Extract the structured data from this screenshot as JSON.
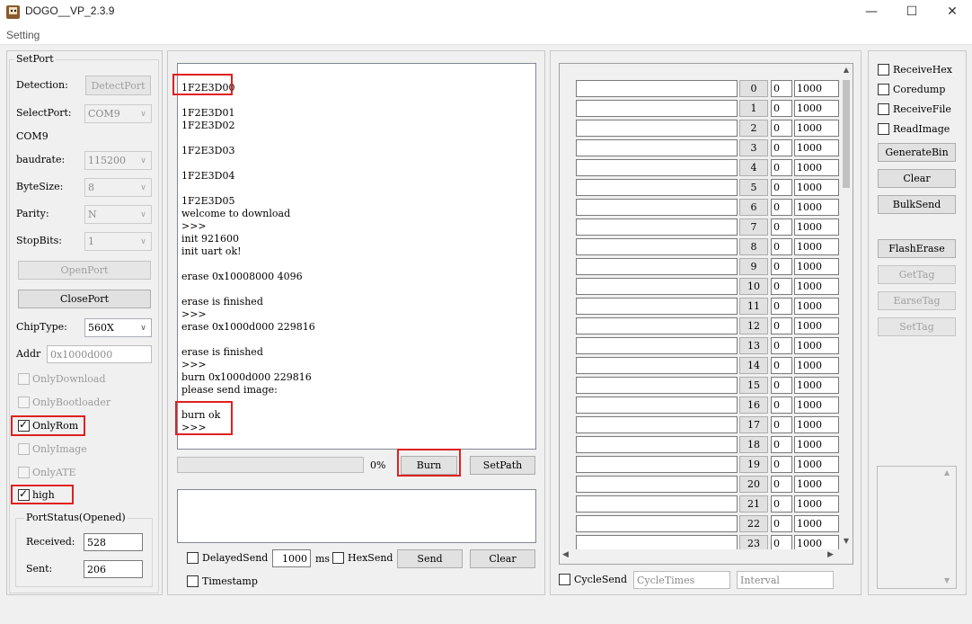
{
  "window": {
    "title": "DOGO__VP_2.3.9",
    "min": "—",
    "max": "☐",
    "close": "✕"
  },
  "menu": {
    "setting": "Setting"
  },
  "setport": {
    "legend": "SetPort",
    "detection_label": "Detection:",
    "detect_button": "DetectPort",
    "selectport_label": "SelectPort:",
    "selectport_value": "COM9",
    "com_text": "COM9",
    "baudrate_label": "baudrate:",
    "baudrate_value": "115200",
    "bytesize_label": "ByteSize:",
    "bytesize_value": "8",
    "parity_label": "Parity:",
    "parity_value": "N",
    "stopbits_label": "StopBits:",
    "stopbits_value": "1",
    "openport_button": "OpenPort",
    "closeport_button": "ClosePort",
    "chiptype_label": "ChipType:",
    "chiptype_value": "560X",
    "addr_label": "Addr",
    "addr_value": "0x1000d000",
    "only_download": "OnlyDownload",
    "only_bootloader": "OnlyBootloader",
    "only_rom": "OnlyRom",
    "only_image": "OnlyImage",
    "only_ate": "OnlyATE",
    "high": "high"
  },
  "portstatus": {
    "legend": "PortStatus(Opened)",
    "received_label": "Received:",
    "received_value": "528",
    "sent_label": "Sent:",
    "sent_value": "206"
  },
  "console": {
    "lines": [
      "",
      "1F2E3D00",
      "",
      "1F2E3D01",
      "1F2E3D02",
      "",
      "1F2E3D03",
      "",
      "1F2E3D04",
      "",
      "1F2E3D05",
      "welcome to download",
      ">>>",
      "init 921600",
      "init uart ok!",
      "",
      "erase 0x10008000 4096",
      "",
      "erase is finished",
      ">>>",
      "erase 0x1000d000 229816",
      "",
      "erase is finished",
      ">>>",
      "burn 0x1000d000 229816",
      "please send image:",
      "",
      "burn ok",
      ">>>"
    ]
  },
  "progress": {
    "percent_text": "0%",
    "fraction": 0
  },
  "buttons": {
    "burn": "Burn",
    "setpath": "SetPath",
    "send": "Send",
    "clear": "Clear"
  },
  "send_options": {
    "delayed_send": "DelayedSend",
    "delay_value": "1000",
    "ms": "ms",
    "hex_send": "HexSend",
    "timestamp": "Timestamp"
  },
  "multi_send": {
    "rows": [
      {
        "num": "0",
        "flag": "0",
        "delay": "1000"
      },
      {
        "num": "1",
        "flag": "0",
        "delay": "1000"
      },
      {
        "num": "2",
        "flag": "0",
        "delay": "1000"
      },
      {
        "num": "3",
        "flag": "0",
        "delay": "1000"
      },
      {
        "num": "4",
        "flag": "0",
        "delay": "1000"
      },
      {
        "num": "5",
        "flag": "0",
        "delay": "1000"
      },
      {
        "num": "6",
        "flag": "0",
        "delay": "1000"
      },
      {
        "num": "7",
        "flag": "0",
        "delay": "1000"
      },
      {
        "num": "8",
        "flag": "0",
        "delay": "1000"
      },
      {
        "num": "9",
        "flag": "0",
        "delay": "1000"
      },
      {
        "num": "10",
        "flag": "0",
        "delay": "1000"
      },
      {
        "num": "11",
        "flag": "0",
        "delay": "1000"
      },
      {
        "num": "12",
        "flag": "0",
        "delay": "1000"
      },
      {
        "num": "13",
        "flag": "0",
        "delay": "1000"
      },
      {
        "num": "14",
        "flag": "0",
        "delay": "1000"
      },
      {
        "num": "15",
        "flag": "0",
        "delay": "1000"
      },
      {
        "num": "16",
        "flag": "0",
        "delay": "1000"
      },
      {
        "num": "17",
        "flag": "0",
        "delay": "1000"
      },
      {
        "num": "18",
        "flag": "0",
        "delay": "1000"
      },
      {
        "num": "19",
        "flag": "0",
        "delay": "1000"
      },
      {
        "num": "20",
        "flag": "0",
        "delay": "1000"
      },
      {
        "num": "21",
        "flag": "0",
        "delay": "1000"
      },
      {
        "num": "22",
        "flag": "0",
        "delay": "1000"
      },
      {
        "num": "23",
        "flag": "0",
        "delay": "1000"
      }
    ],
    "cycle_send": "CycleSend",
    "cycle_times_placeholder": "CycleTimes",
    "interval_placeholder": "Interval"
  },
  "right": {
    "receive_hex": "ReceiveHex",
    "coredump": "Coredump",
    "receive_file": "ReceiveFile",
    "read_image": "ReadImage",
    "generate_bin": "GenerateBin",
    "clear": "Clear",
    "bulk_send": "BulkSend",
    "flash_erase": "FlashErase",
    "get_tag": "GetTag",
    "erase_tag": "EarseTag",
    "set_tag": "SetTag"
  }
}
